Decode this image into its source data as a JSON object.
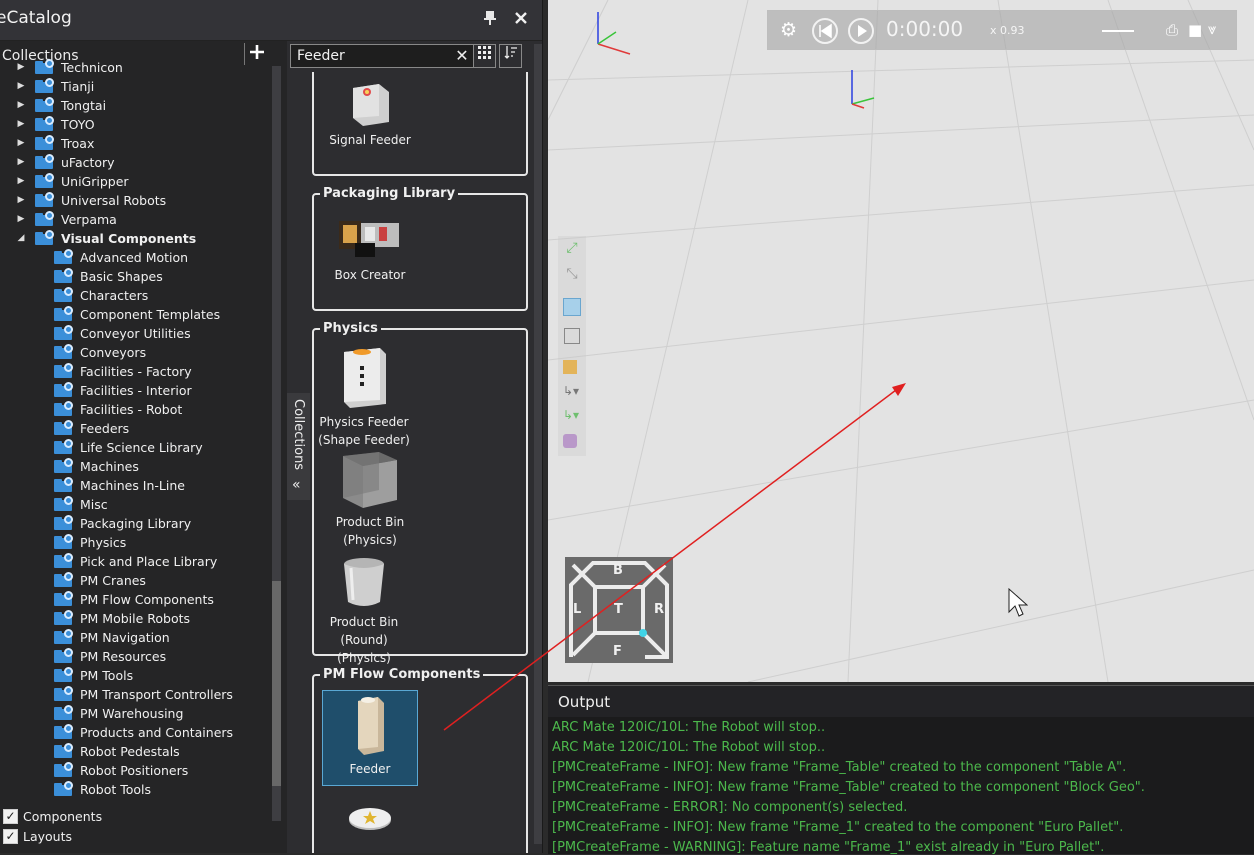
{
  "catalog": {
    "title": "eCatalog",
    "collections_label": "Collections",
    "tree_items": [
      {
        "label": "Technicon",
        "level": 1,
        "expanded": false
      },
      {
        "label": "Tianji",
        "level": 1,
        "expanded": false
      },
      {
        "label": "Tongtai",
        "level": 1,
        "expanded": false
      },
      {
        "label": "TOYO",
        "level": 1,
        "expanded": false
      },
      {
        "label": "Troax",
        "level": 1,
        "expanded": false
      },
      {
        "label": "uFactory",
        "level": 1,
        "expanded": false
      },
      {
        "label": "UniGripper",
        "level": 1,
        "expanded": false
      },
      {
        "label": "Universal Robots",
        "level": 1,
        "expanded": false
      },
      {
        "label": "Verpama",
        "level": 1,
        "expanded": false
      },
      {
        "label": "Visual Components",
        "level": 1,
        "expanded": true
      },
      {
        "label": "Advanced Motion",
        "level": 2
      },
      {
        "label": "Basic Shapes",
        "level": 2
      },
      {
        "label": "Characters",
        "level": 2
      },
      {
        "label": "Component Templates",
        "level": 2
      },
      {
        "label": "Conveyor Utilities",
        "level": 2
      },
      {
        "label": "Conveyors",
        "level": 2
      },
      {
        "label": "Facilities - Factory",
        "level": 2
      },
      {
        "label": "Facilities - Interior",
        "level": 2
      },
      {
        "label": "Facilities - Robot",
        "level": 2
      },
      {
        "label": "Feeders",
        "level": 2
      },
      {
        "label": "Life Science Library",
        "level": 2
      },
      {
        "label": "Machines",
        "level": 2
      },
      {
        "label": "Machines In-Line",
        "level": 2
      },
      {
        "label": "Misc",
        "level": 2
      },
      {
        "label": "Packaging Library",
        "level": 2
      },
      {
        "label": "Physics",
        "level": 2
      },
      {
        "label": "Pick and Place Library",
        "level": 2
      },
      {
        "label": "PM Cranes",
        "level": 2
      },
      {
        "label": "PM Flow Components",
        "level": 2
      },
      {
        "label": "PM Mobile Robots",
        "level": 2
      },
      {
        "label": "PM Navigation",
        "level": 2
      },
      {
        "label": "PM Resources",
        "level": 2
      },
      {
        "label": "PM Tools",
        "level": 2
      },
      {
        "label": "PM Transport Controllers",
        "level": 2
      },
      {
        "label": "PM Warehousing",
        "level": 2
      },
      {
        "label": "Products and Containers",
        "level": 2
      },
      {
        "label": "Robot Pedestals",
        "level": 2
      },
      {
        "label": "Robot Positioners",
        "level": 2
      },
      {
        "label": "Robot Tools",
        "level": 2
      }
    ],
    "checkboxes": [
      {
        "label": "Components",
        "checked": true
      },
      {
        "label": "Layouts",
        "checked": true
      }
    ],
    "side_tab_label": "Collections",
    "search": {
      "value": "Feeder"
    },
    "groups": [
      {
        "title": "",
        "items": [
          {
            "label": "Signal Feeder"
          }
        ]
      },
      {
        "title": "Packaging Library",
        "items": [
          {
            "label": "Box Creator"
          }
        ]
      },
      {
        "title": "Physics",
        "items": [
          {
            "label": "Physics Feeder (Shape Feeder)"
          },
          {
            "label": "Product Bin (Physics)"
          },
          {
            "label": "Product Bin (Round) (Physics)"
          }
        ]
      },
      {
        "title": "PM Flow Components",
        "items": [
          {
            "label": "Feeder",
            "selected": true
          },
          {
            "label": ""
          }
        ]
      }
    ]
  },
  "viewport": {
    "time": "0:00:00",
    "speed": "x 0.93",
    "navcube": {
      "top": "B",
      "left": "L",
      "center": "T",
      "right": "R",
      "bottom": "F"
    }
  },
  "output": {
    "title": "Output",
    "lines": [
      "ARC Mate 120iC/10L: The Robot will stop..",
      "ARC Mate 120iC/10L: The Robot will stop..",
      "[PMCreateFrame - INFO]: New frame \"Frame_Table\" created to the component \"Table A\".",
      "[PMCreateFrame - INFO]: New frame \"Frame_Table\" created to the component \"Block Geo\".",
      "[PMCreateFrame - ERROR]: No component(s) selected.",
      "[PMCreateFrame - INFO]: New frame \"Frame_1\" created to the component \"Euro Pallet\".",
      "[PMCreateFrame - WARNING]: Feature name \"Frame_1\" exist already in \"Euro Pallet\"."
    ],
    "color": "#4cb84c"
  }
}
